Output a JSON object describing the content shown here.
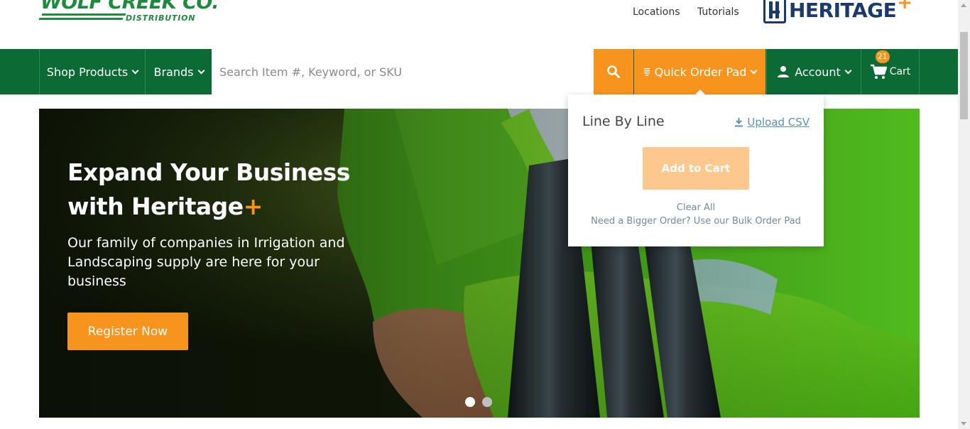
{
  "header": {
    "logo_left": {
      "name": "WOLF CREEK CO.",
      "sub": "DISTRIBUTION"
    },
    "links": [
      "Locations",
      "Tutorials"
    ],
    "logo_right": {
      "name": "HERITAGE",
      "plus": "+"
    }
  },
  "nav": {
    "shop_products": "Shop Products",
    "brands": "Brands",
    "search_placeholder": "Search Item #, Keyword, or SKU",
    "search_icon": "search-icon",
    "quick_order_pad": "Quick Order Pad",
    "account": "Account",
    "cart_label": "Cart",
    "cart_count": "21"
  },
  "quick_order_panel": {
    "title": "Line By Line",
    "upload_csv": "Upload CSV",
    "add_to_cart": "Add to Cart",
    "clear_all": "Clear All",
    "bigger_order": "Need a Bigger Order? Use our Bulk Order Pad"
  },
  "hero": {
    "title_line1": "Expand Your Business",
    "title_line2": "with Heritage",
    "title_plus": "+",
    "subtitle": "Our family of companies in Irrigation and Landscaping supply are here for your business",
    "cta": "Register Now",
    "slides": 2,
    "active_slide": 1
  },
  "colors": {
    "nav_green": "#0c6b35",
    "accent_orange": "#f7941d",
    "brand_navy": "#1b3a6b",
    "brand_green": "#1e8a3d"
  }
}
